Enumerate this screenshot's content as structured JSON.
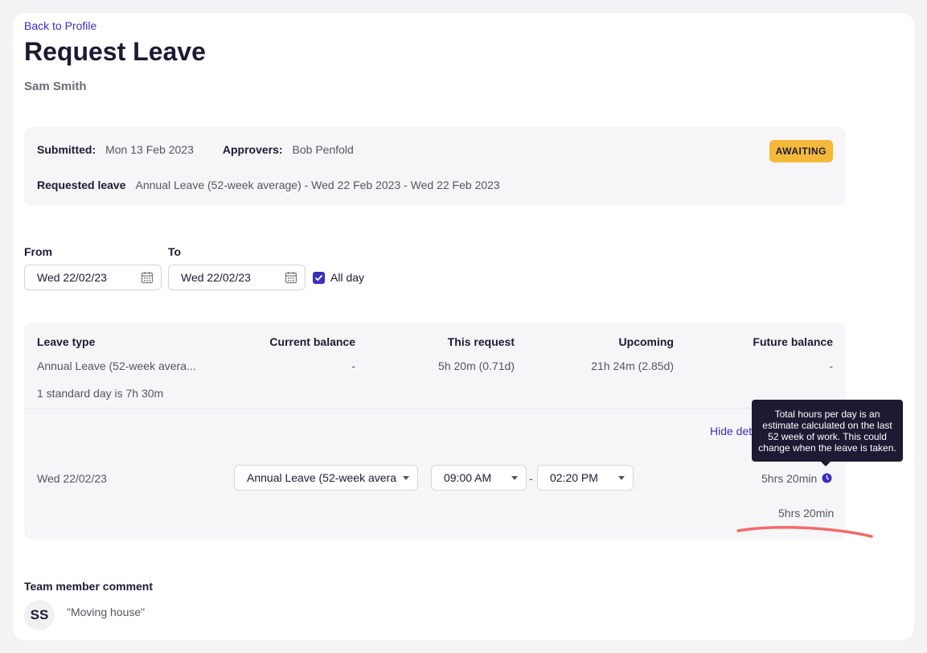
{
  "header": {
    "back_link": "Back to Profile",
    "title": "Request Leave",
    "employee_name": "Sam Smith"
  },
  "summary": {
    "submitted_label": "Submitted:",
    "submitted_value": "Mon 13 Feb 2023",
    "approvers_label": "Approvers:",
    "approvers_value": "Bob Penfold",
    "status_badge": "AWAITING",
    "requested_label": "Requested leave",
    "requested_value": "Annual Leave (52-week average) - Wed 22 Feb 2023 - Wed 22 Feb 2023"
  },
  "dates": {
    "from_label": "From",
    "from_value": "Wed 22/02/23",
    "to_label": "To",
    "to_value": "Wed 22/02/23",
    "all_day_label": "All day",
    "all_day_checked": true
  },
  "leave_table": {
    "headers": {
      "leave_type": "Leave type",
      "current_balance": "Current balance",
      "this_request": "This request",
      "upcoming": "Upcoming",
      "future_balance": "Future balance"
    },
    "row": {
      "leave_type": "Annual Leave (52-week avera...",
      "current_balance": "-",
      "this_request": "5h 20m (0.71d)",
      "upcoming": "21h 24m (2.85d)",
      "future_balance": "-"
    },
    "standard_day": "1 standard day is 7h 30m",
    "hide_details": "Hide det",
    "day_row": {
      "date": "Wed 22/02/23",
      "leave_type_select": "Annual Leave (52-week avera",
      "start_time": "09:00 AM",
      "separator": "-",
      "end_time": "02:20 PM",
      "hours": "5hrs 20min"
    },
    "total_hours": "5hrs 20min"
  },
  "tooltip": {
    "text": "Total hours per day is an estimate calculated on the last 52 week of work. This could change when the leave is taken."
  },
  "comment": {
    "heading": "Team member comment",
    "avatar_initials": "SS",
    "text": "\"Moving house\""
  },
  "colors": {
    "accent": "#3b2dbf",
    "badge": "#f4b93a",
    "tooltip_bg": "#1c1b33",
    "annotation_underline": "#f26b6b"
  }
}
